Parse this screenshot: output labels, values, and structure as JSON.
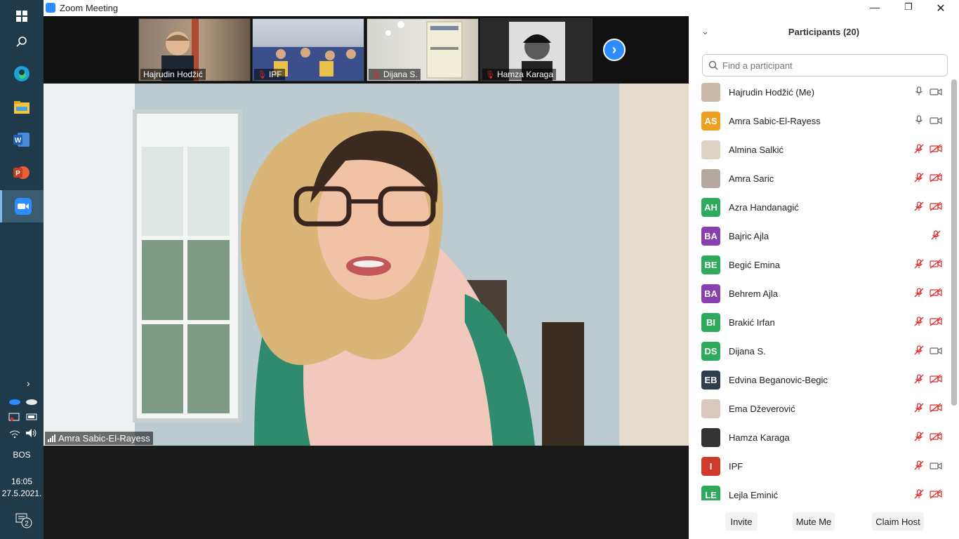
{
  "window": {
    "title": "Zoom Meeting"
  },
  "taskbar": {
    "language": "BOS",
    "time": "16:05",
    "date": "27.5.2021.",
    "notification_count": "2"
  },
  "thumbnails": [
    {
      "name": "Hajrudin Hodžić",
      "muted": false
    },
    {
      "name": "IPF",
      "muted": true
    },
    {
      "name": "Dijana S.",
      "muted": true
    },
    {
      "name": "Hamza Karaga",
      "muted": true
    }
  ],
  "speaker": {
    "name": "Amra Sabic-El-Rayess"
  },
  "panel": {
    "title": "Participants (20)",
    "search_placeholder": "Find a participant",
    "participants": [
      {
        "name": "Hajrudin Hodžić (Me)",
        "initials": "",
        "avatar_color": "#c9b9a7",
        "mic": "on",
        "cam": "on"
      },
      {
        "name": "Amra Sabic-El-Rayess",
        "initials": "AS",
        "avatar_color": "#f0a020",
        "mic": "on",
        "cam": "on"
      },
      {
        "name": "Almina Salkić",
        "initials": "",
        "avatar_color": "#ddd3c2",
        "mic": "off",
        "cam": "off"
      },
      {
        "name": "Amra Saric",
        "initials": "",
        "avatar_color": "#b5a8a0",
        "mic": "off",
        "cam": "off"
      },
      {
        "name": "Azra Handanagić",
        "initials": "AH",
        "avatar_color": "#2eaa5c",
        "mic": "off",
        "cam": "off"
      },
      {
        "name": "Bajric Ajla",
        "initials": "BA",
        "avatar_color": "#8a3fb0",
        "mic": "off",
        "cam": "none"
      },
      {
        "name": "Begić Emina",
        "initials": "BE",
        "avatar_color": "#2eaa5c",
        "mic": "off",
        "cam": "off"
      },
      {
        "name": "Behrem Ajla",
        "initials": "BA",
        "avatar_color": "#8a3fb0",
        "mic": "off",
        "cam": "off"
      },
      {
        "name": "Brakić Irfan",
        "initials": "BI",
        "avatar_color": "#2eaa5c",
        "mic": "off",
        "cam": "off"
      },
      {
        "name": "Dijana S.",
        "initials": "DS",
        "avatar_color": "#2eaa5c",
        "mic": "off",
        "cam": "on"
      },
      {
        "name": "Edvina Beganovic-Begic",
        "initials": "EB",
        "avatar_color": "#2f3e4e",
        "mic": "off",
        "cam": "off"
      },
      {
        "name": "Ema Dževerović",
        "initials": "",
        "avatar_color": "#d8c8c0",
        "mic": "off",
        "cam": "off"
      },
      {
        "name": "Hamza Karaga",
        "initials": "",
        "avatar_color": "#333333",
        "mic": "off",
        "cam": "off"
      },
      {
        "name": "IPF",
        "initials": "I",
        "avatar_color": "#d03a2a",
        "mic": "off",
        "cam": "on"
      },
      {
        "name": "Lejla Eminić",
        "initials": "LE",
        "avatar_color": "#2eaa5c",
        "mic": "off",
        "cam": "off"
      }
    ],
    "buttons": {
      "invite": "Invite",
      "mute_me": "Mute Me",
      "claim_host": "Claim Host"
    }
  }
}
